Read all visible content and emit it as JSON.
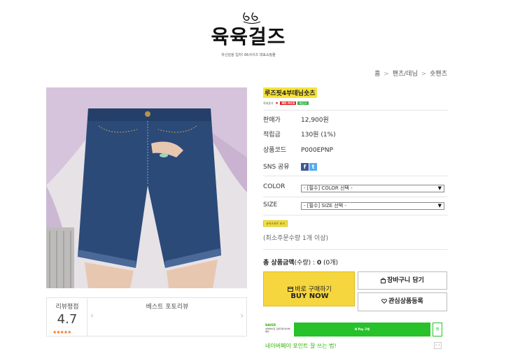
{
  "header": {
    "logo_mark": "66",
    "logo_text": "육육걸즈",
    "logo_subtitle": "자신감을 입자! 66사이즈 대표쇼핑몰"
  },
  "breadcrumb": {
    "home": "홈",
    "category": "팬츠/데님",
    "current": "숏팬츠",
    "separator": ">"
  },
  "review": {
    "score_label": "리뷰평점",
    "score_value": "4.7",
    "stars": "★★★★★",
    "best_title": "베스트 포토리뷰",
    "prev": "‹",
    "next": "›"
  },
  "product": {
    "name": "루즈핏4부데님숏츠",
    "badges": [
      "육대류가",
      "♥",
      "MD PICK",
      "재입고"
    ],
    "price_label": "판매가",
    "price_value": "12,900원",
    "points_label": "적립금",
    "points_value": "130원 (1%)",
    "code_label": "상품코드",
    "code_value": "P000EPNP",
    "sns_label": "SNS 공유",
    "sns_facebook": "f",
    "sns_twitter": "t"
  },
  "options": {
    "color_label": "COLOR",
    "color_value": "- [필수] COLOR 선택 -",
    "size_label": "SIZE",
    "size_value": "- [필수] SIZE 선택 -",
    "dropdown_icon": "▼",
    "size_chart": "사이즈차트 보기",
    "min_order": "(최소주문수량 1개 이상)"
  },
  "total": {
    "label": "총 상품금액",
    "qty_label": "(수량) : ",
    "amount": "0",
    "qty": " (0개)"
  },
  "actions": {
    "buy_line1": "바로 구매하기",
    "buy_line2": "BUY NOW",
    "cart": "장바구니 담기",
    "wishlist": "관심상품등록"
  },
  "naver_pay": {
    "logo": "NAVER",
    "desc": "네이버ID로 간편구매 네이버페이",
    "button": "N Pay 구매",
    "wish": "찜",
    "promo": "네이버페이 포인트 잘 쓰는 법!",
    "arrows": "‹ ›"
  },
  "colors": {
    "accent_yellow": "#f5d63f",
    "highlight_yellow": "#f5e23a",
    "naver_green": "#27c12a",
    "star_orange": "#f07a2a"
  }
}
